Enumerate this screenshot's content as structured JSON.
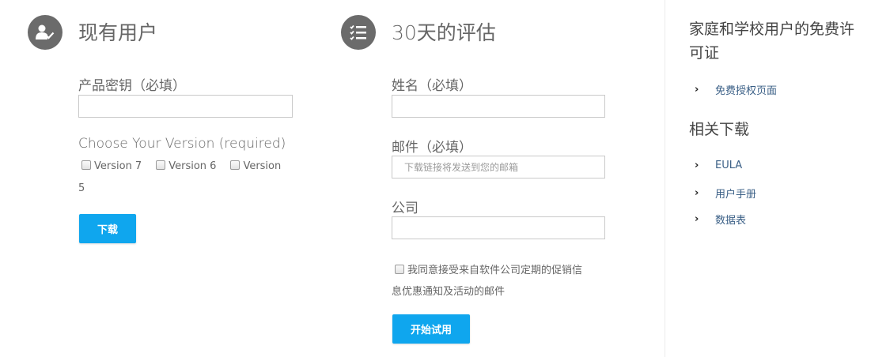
{
  "existing": {
    "title": "现有用户",
    "product_key_label": "产品密钥（必填）",
    "version_label": "Choose Your Version (required)",
    "versions": [
      "Version 7",
      "Version 6",
      "Version"
    ],
    "version_wrap": "5",
    "download_button": "下载"
  },
  "trial": {
    "title": "30天的评估",
    "name_label": "姓名（必填）",
    "email_label": "邮件（必填）",
    "email_placeholder": "下载链接将发送到您的邮箱",
    "company_label": "公司",
    "consent_line1": "我同意接受来自软件公司定期的促销信",
    "consent_line2": "息优惠通知及活动的邮件",
    "start_button": "开始试用"
  },
  "sidebar": {
    "license_title_line1": "家庭和学校用户的免费许",
    "license_title_line2": "可证",
    "license_link": "免费授权页面",
    "downloads_title": "相关下载",
    "downloads": [
      "EULA",
      "用户手册",
      "数据表"
    ]
  },
  "colors": {
    "accent": "#0fa6ee",
    "icon_bg": "#6b6b6b",
    "link": "#3a5f86"
  },
  "icons": {
    "existing": "user-check-icon",
    "trial": "checklist-icon",
    "link_arrow": "chevron-right-icon"
  }
}
